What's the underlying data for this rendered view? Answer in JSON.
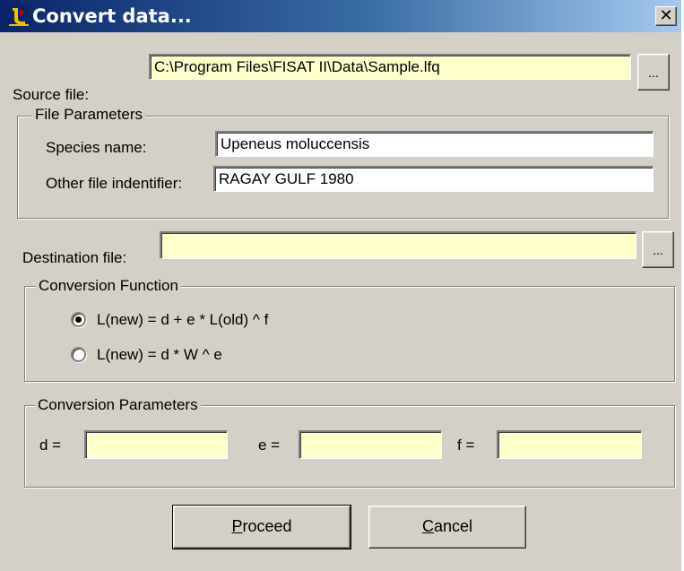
{
  "window": {
    "title": "Convert data...",
    "close_glyph": "✕"
  },
  "source": {
    "label": "Source file:",
    "value": "C:\\Program Files\\FISAT II\\Data\\Sample.lfq",
    "browse_label": "..."
  },
  "file_parameters": {
    "title": "File Parameters",
    "species_label": "Species name:",
    "species_value": "Upeneus moluccensis",
    "identifier_label": "Other file indentifier:",
    "identifier_value": "RAGAY GULF 1980"
  },
  "destination": {
    "label": "Destination file:",
    "value": "",
    "browse_label": "..."
  },
  "conversion_function": {
    "title": "Conversion Function",
    "options": [
      {
        "label": "L(new) = d + e * L(old) ^ f",
        "selected": true
      },
      {
        "label": "L(new) = d *  W ^ e",
        "selected": false
      }
    ]
  },
  "conversion_parameters": {
    "title": "Conversion Parameters",
    "d_label": "d =",
    "d_value": "",
    "e_label": "e =",
    "e_value": "",
    "f_label": "f =",
    "f_value": ""
  },
  "buttons": {
    "proceed": "Proceed",
    "cancel": "Cancel"
  },
  "colors": {
    "field_highlight": "#ffffcc",
    "dialog_face": "#d4d0c8",
    "titlebar": "#0a246a"
  }
}
